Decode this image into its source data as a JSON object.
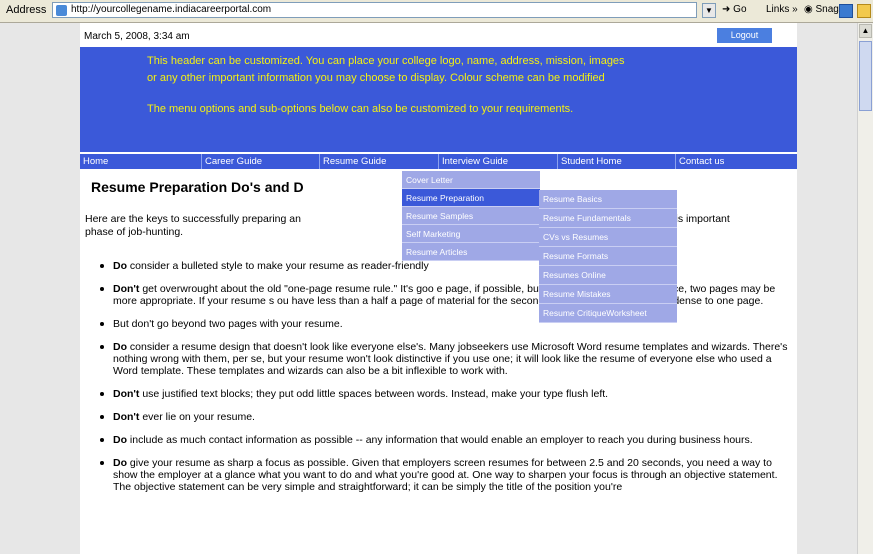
{
  "addressbar": {
    "label": "Address",
    "url": "http://yourcollegename.indiacareerportal.com",
    "go": "Go",
    "links": "Links »",
    "snagit": "SnagIt"
  },
  "page": {
    "datetime": "March 5, 2008, 3:34 am",
    "logout": "Logout",
    "header_lines": [
      "This header can be customized. You can place your college logo, name, address, mission, images",
      "or any other important information you may choose to display. Colour scheme can be modified",
      "The menu options and sub-options below can also be customized to your requirements."
    ],
    "nav": [
      "Home",
      "Career Guide",
      "Resume Guide",
      "Interview Guide",
      "Student Home",
      "Contact us"
    ],
    "resume_menu": [
      "Cover Letter",
      "Resume Preparation",
      "Resume Samples",
      "Self Marketing",
      "Resume Articles"
    ],
    "resume_submenu": [
      "Resume Basics",
      "Resume Fundamentals",
      "CVs vs Resumes",
      "Resume Formats",
      "Resumes Online",
      "Resume Mistakes",
      "Resume CritiqueWorksheet"
    ],
    "title": "Resume Preparation Do's and D",
    "intro_a": "Here are the keys to successfully preparing an",
    "intro_b": "ould achieve success in this important",
    "intro_c": "phase of job-hunting.",
    "bullets": [
      {
        "b": "Do",
        "t": " consider a bulleted style to make your resume as reader-friendly"
      },
      {
        "b": "Don't",
        "t": " get overwrought about the old \"one-page resume rule.\" It's goo                                                         e page, if possible, but if you have a lot of experience, two pages may be more appropriate. If your resume s                                                         ou have less than a half a page of material for the second page, it may be best to condense to one page."
      },
      {
        "b": "",
        "t": "But don't go beyond two pages with your resume."
      },
      {
        "b": "Do",
        "t": " consider a resume design that doesn't look like everyone else's. Many jobseekers use Microsoft Word resume templates and wizards. There's nothing wrong with them, per se, but your resume won't look distinctive if you use one; it will look like the resume of everyone else who used a Word template. These templates and wizards can also be a bit inflexible to work with."
      },
      {
        "b": "Don't",
        "t": " use justified text blocks; they put odd little spaces between words. Instead, make your type flush left."
      },
      {
        "b": "Don't",
        "t": " ever lie on your resume."
      },
      {
        "b": "Do",
        "t": " include as much contact information as possible -- any information that would enable an employer to reach you during business hours."
      },
      {
        "b": "Do",
        "t": " give your resume as sharp a focus as possible. Given that employers screen resumes for between 2.5 and 20 seconds, you need a way to show the employer at a glance what you want to do and what you're good at. One way to sharpen your focus is through an objective statement. The objective statement can be very simple and straightforward; it can be simply the title of the position you're"
      }
    ]
  }
}
